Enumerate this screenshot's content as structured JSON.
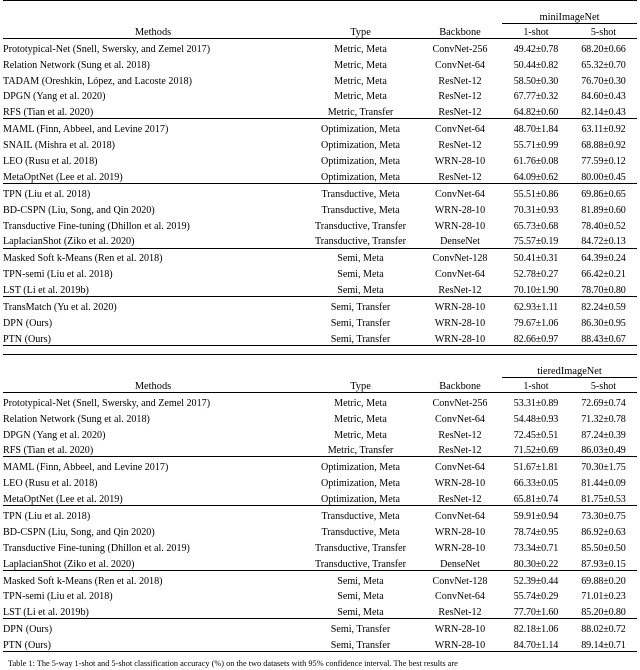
{
  "tables": [
    {
      "id": "mini",
      "dataset": "miniImageNet",
      "headers": {
        "methods": "Methods",
        "type": "Type",
        "backbone": "Backbone",
        "shot1": "1-shot",
        "shot5": "5-shot"
      },
      "groups": [
        {
          "rows": [
            {
              "method": "Prototypical-Net (Snell, Swersky, and Zemel 2017)",
              "type": "Metric, Meta",
              "backbone": "ConvNet-256",
              "s1": "49.42±0.78",
              "s5": "68.20±0.66",
              "bold": false
            },
            {
              "method": "Relation Network (Sung et al. 2018)",
              "type": "Metric, Meta",
              "backbone": "ConvNet-64",
              "s1": "50.44±0.82",
              "s5": "65.32±0.70",
              "bold": false
            },
            {
              "method": "TADAM (Oreshkin, López, and Lacoste 2018)",
              "type": "Metric, Meta",
              "backbone": "ResNet-12",
              "s1": "58.50±0.30",
              "s5": "76.70±0.30",
              "bold": false
            },
            {
              "method": "DPGN (Yang et al. 2020)",
              "type": "Metric, Meta",
              "backbone": "ResNet-12",
              "s1": "67.77±0.32",
              "s5": "84.60±0.43",
              "bold": false
            },
            {
              "method": "RFS (Tian et al. 2020)",
              "type": "Metric, Transfer",
              "backbone": "ResNet-12",
              "s1": "64.82±0.60",
              "s5": "82.14±0.43",
              "bold": false
            }
          ]
        },
        {
          "rows": [
            {
              "method": "MAML (Finn, Abbeel, and Levine 2017)",
              "type": "Optimization, Meta",
              "backbone": "ConvNet-64",
              "s1": "48.70±1.84",
              "s5": "63.11±0.92",
              "bold": false
            },
            {
              "method": "SNAIL (Mishra et al. 2018)",
              "type": "Optimization, Meta",
              "backbone": "ResNet-12",
              "s1": "55.71±0.99",
              "s5": "68.88±0.92",
              "bold": false
            },
            {
              "method": "LEO (Rusu et al. 2018)",
              "type": "Optimization, Meta",
              "backbone": "WRN-28-10",
              "s1": "61.76±0.08",
              "s5": "77.59±0.12",
              "bold": false
            },
            {
              "method": "MetaOptNet (Lee et al. 2019)",
              "type": "Optimization, Meta",
              "backbone": "ResNet-12",
              "s1": "64.09±0.62",
              "s5": "80.00±0.45",
              "bold": false
            }
          ]
        },
        {
          "rows": [
            {
              "method": "TPN (Liu et al. 2018)",
              "type": "Transductive, Meta",
              "backbone": "ConvNet-64",
              "s1": "55.51±0.86",
              "s5": "69.86±0.65",
              "bold": false
            },
            {
              "method": "BD-CSPN (Liu, Song, and Qin 2020)",
              "type": "Transductive, Meta",
              "backbone": "WRN-28-10",
              "s1": "70.31±0.93",
              "s5": "81.89±0.60",
              "bold": false
            },
            {
              "method": "Transductive Fine-tuning (Dhillon et al. 2019)",
              "type": "Transductive, Transfer",
              "backbone": "WRN-28-10",
              "s1": "65.73±0.68",
              "s5": "78.40±0.52",
              "bold": false
            },
            {
              "method": "LaplacianShot (Ziko et al. 2020)",
              "type": "Transductive, Transfer",
              "backbone": "DenseNet",
              "s1": "75.57±0.19",
              "s5": "84.72±0.13",
              "bold": false
            }
          ]
        },
        {
          "rows": [
            {
              "method": "Masked Soft k-Means (Ren et al. 2018)",
              "type": "Semi, Meta",
              "backbone": "ConvNet-128",
              "s1": "50.41±0.31",
              "s5": "64.39±0.24",
              "bold": false
            },
            {
              "method": "TPN-semi (Liu et al. 2018)",
              "type": "Semi, Meta",
              "backbone": "ConvNet-64",
              "s1": "52.78±0.27",
              "s5": "66.42±0.21",
              "bold": false
            },
            {
              "method": "LST (Li et al. 2019b)",
              "type": "Semi, Meta",
              "backbone": "ResNet-12",
              "s1": "70.10±1.90",
              "s5": "78.70±0.80",
              "bold": false
            }
          ]
        },
        {
          "rows": [
            {
              "method": "TransMatch (Yu et al. 2020)",
              "type": "Semi, Transfer",
              "backbone": "WRN-28-10",
              "s1": "62.93±1.11",
              "s5": "82.24±0.59",
              "bold": false
            },
            {
              "method": "DPN (Ours)",
              "type": "Semi, Transfer",
              "backbone": "WRN-28-10",
              "s1": "79.67±1.06",
              "s5": "86.30±0.95",
              "bold": false
            },
            {
              "method": "PTN (Ours)",
              "type": "Semi, Transfer",
              "backbone": "WRN-28-10",
              "s1": "82.66±0.97",
              "s5": "88.43±0.67",
              "bold": true
            }
          ]
        }
      ]
    },
    {
      "id": "tiered",
      "dataset": "tieredImageNet",
      "headers": {
        "methods": "Methods",
        "type": "Type",
        "backbone": "Backbone",
        "shot1": "1-shot",
        "shot5": "5-shot"
      },
      "groups": [
        {
          "rows": [
            {
              "method": "Prototypical-Net (Snell, Swersky, and Zemel 2017)",
              "type": "Metric, Meta",
              "backbone": "ConvNet-256",
              "s1": "53.31±0.89",
              "s5": "72.69±0.74",
              "bold": false
            },
            {
              "method": "Relation Network (Sung et al. 2018)",
              "type": "Metric, Meta",
              "backbone": "ConvNet-64",
              "s1": "54.48±0.93",
              "s5": "71.32±0.78",
              "bold": false
            },
            {
              "method": "DPGN (Yang et al. 2020)",
              "type": "Metric, Meta",
              "backbone": "ResNet-12",
              "s1": "72.45±0.51",
              "s5": "87.24±0.39",
              "bold": false
            },
            {
              "method": "RFS (Tian et al. 2020)",
              "type": "Metric, Transfer",
              "backbone": "ResNet-12",
              "s1": "71.52±0.69",
              "s5": "86.03±0.49",
              "bold": false
            }
          ]
        },
        {
          "rows": [
            {
              "method": "MAML (Finn, Abbeel, and Levine 2017)",
              "type": "Optimization, Meta",
              "backbone": "ConvNet-64",
              "s1": "51.67±1.81",
              "s5": "70.30±1.75",
              "bold": false
            },
            {
              "method": "LEO (Rusu et al. 2018)",
              "type": "Optimization, Meta",
              "backbone": "WRN-28-10",
              "s1": "66.33±0.05",
              "s5": "81.44±0.09",
              "bold": false
            },
            {
              "method": "MetaOptNet (Lee et al. 2019)",
              "type": "Optimization, Meta",
              "backbone": "ResNet-12",
              "s1": "65.81±0.74",
              "s5": "81.75±0.53",
              "bold": false
            }
          ]
        },
        {
          "rows": [
            {
              "method": "TPN (Liu et al. 2018)",
              "type": "Transductive, Meta",
              "backbone": "ConvNet-64",
              "s1": "59.91±0.94",
              "s5": "73.30±0.75",
              "bold": false
            },
            {
              "method": "BD-CSPN (Liu, Song, and Qin 2020)",
              "type": "Transductive, Meta",
              "backbone": "WRN-28-10",
              "s1": "78.74±0.95",
              "s5": "86.92±0.63",
              "bold": false
            },
            {
              "method": "Transductive Fine-tuning (Dhillon et al. 2019)",
              "type": "Transductive, Transfer",
              "backbone": "WRN-28-10",
              "s1": "73.34±0.71",
              "s5": "85.50±0.50",
              "bold": false
            },
            {
              "method": "LaplacianShot (Ziko et al. 2020)",
              "type": "Transductive, Transfer",
              "backbone": "DenseNet",
              "s1": "80.30±0.22",
              "s5": "87.93±0.15",
              "bold": false
            }
          ]
        },
        {
          "rows": [
            {
              "method": "Masked Soft k-Means (Ren et al. 2018)",
              "type": "Semi, Meta",
              "backbone": "ConvNet-128",
              "s1": "52.39±0.44",
              "s5": "69.88±0.20",
              "bold": false
            },
            {
              "method": "TPN-semi (Liu et al. 2018)",
              "type": "Semi, Meta",
              "backbone": "ConvNet-64",
              "s1": "55.74±0.29",
              "s5": "71.01±0.23",
              "bold": false
            },
            {
              "method": "LST (Li et al. 2019b)",
              "type": "Semi, Meta",
              "backbone": "ResNet-12",
              "s1": "77.70±1.60",
              "s5": "85.20±0.80",
              "bold": false
            }
          ]
        },
        {
          "rows": [
            {
              "method": "DPN (Ours)",
              "type": "Semi, Transfer",
              "backbone": "WRN-28-10",
              "s1": "82.18±1.06",
              "s5": "88.02±0.72",
              "bold": false
            },
            {
              "method": "PTN (Ours)",
              "type": "Semi, Transfer",
              "backbone": "WRN-28-10",
              "s1": "84.70±1.14",
              "s5": "89.14±0.71",
              "bold": true
            }
          ]
        }
      ]
    }
  ],
  "caption": "Table 1: The 5-way 1-shot and 5-shot classification accuracy (%) on the two datasets with 95% confidence interval. The best results are"
}
